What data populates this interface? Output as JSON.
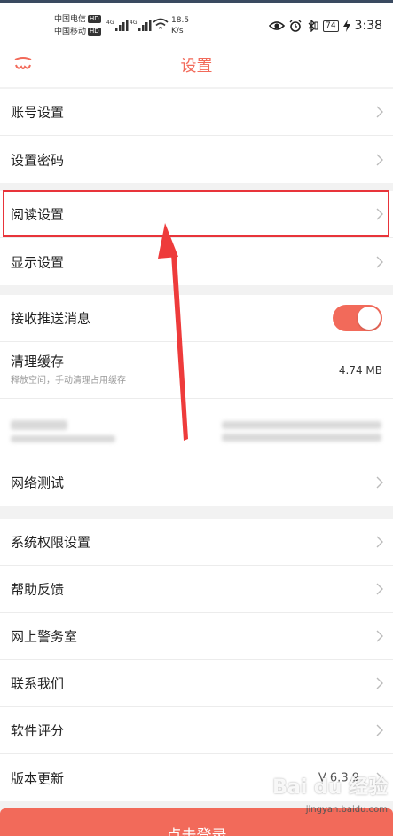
{
  "status_bar": {
    "carrier1": "中国电信",
    "carrier2": "中国移动",
    "hd": "HD",
    "net_speed_value": "18.5",
    "net_speed_unit": "K/s",
    "battery": "74",
    "time": "3:38"
  },
  "header": {
    "title": "设置"
  },
  "groups": {
    "account": [
      {
        "label": "账号设置"
      },
      {
        "label": "设置密码"
      }
    ],
    "reading": [
      {
        "label": "阅读设置"
      },
      {
        "label": "显示设置"
      }
    ],
    "misc": {
      "push_label": "接收推送消息",
      "push_enabled": true,
      "cache_label": "清理缓存",
      "cache_sub": "释放空间，手动清理占用缓存",
      "cache_value": "4.74 MB",
      "network_label": "网络测试"
    },
    "system": [
      {
        "label": "系统权限设置"
      },
      {
        "label": "帮助反馈"
      },
      {
        "label": "网上警务室"
      },
      {
        "label": "联系我们"
      },
      {
        "label": "软件评分"
      },
      {
        "label": "版本更新",
        "value": "V 6.3.9"
      }
    ]
  },
  "footer": {
    "login_label": "点击登录"
  },
  "watermark": {
    "brand": "Bai du 经验",
    "url": "jingyan.baidu.com"
  },
  "colors": {
    "accent": "#f26a5a",
    "highlight": "#e8343a"
  }
}
